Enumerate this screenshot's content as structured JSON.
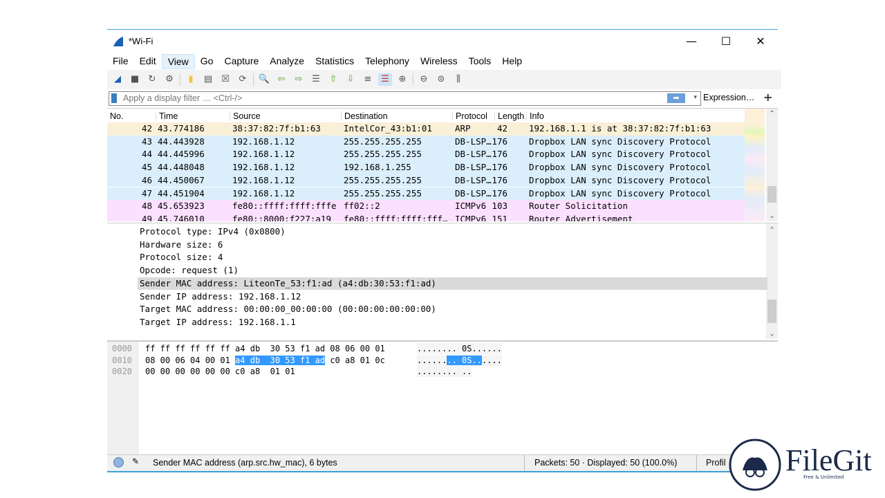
{
  "window": {
    "title": "*Wi-Fi",
    "minimize": "—",
    "maximize": "☐",
    "close": "✕"
  },
  "menu": [
    "File",
    "Edit",
    "View",
    "Go",
    "Capture",
    "Analyze",
    "Statistics",
    "Telephony",
    "Wireless",
    "Tools",
    "Help"
  ],
  "toolbar": [
    "start-capture",
    "stop-capture",
    "restart-capture",
    "capture-options",
    "open-file",
    "save-file",
    "close-file",
    "reload-file",
    "find-packet",
    "go-back",
    "go-forward",
    "go-to-packet",
    "first-packet",
    "last-packet",
    "auto-scroll",
    "colorize",
    "zoom-in",
    "zoom-out",
    "normal-size",
    "resize-columns"
  ],
  "filter": {
    "placeholder": "Apply a display filter … <Ctrl-/>",
    "apply": "➡",
    "dropdown": "▾",
    "expression": "Expression…",
    "plus": "+"
  },
  "packet_list": {
    "columns": [
      "No.",
      "Time",
      "Source",
      "Destination",
      "Protocol",
      "Length",
      "Info"
    ],
    "rows": [
      {
        "no": "42",
        "time": "43.774186",
        "src": "38:37:82:7f:b1:63",
        "dst": "IntelCor_43:b1:01",
        "proto": "ARP",
        "len": "42",
        "info": "192.168.1.1 is at 38:37:82:7f:b1:63",
        "color": "#faf0d7"
      },
      {
        "no": "43",
        "time": "44.443928",
        "src": "192.168.1.12",
        "dst": "255.255.255.255",
        "proto": "DB-LSP…",
        "len": "176",
        "info": "Dropbox LAN sync Discovery Protocol",
        "color": "#daeefb"
      },
      {
        "no": "44",
        "time": "44.445996",
        "src": "192.168.1.12",
        "dst": "255.255.255.255",
        "proto": "DB-LSP…",
        "len": "176",
        "info": "Dropbox LAN sync Discovery Protocol",
        "color": "#daeefb"
      },
      {
        "no": "45",
        "time": "44.448048",
        "src": "192.168.1.12",
        "dst": "192.168.1.255",
        "proto": "DB-LSP…",
        "len": "176",
        "info": "Dropbox LAN sync Discovery Protocol",
        "color": "#daeefb"
      },
      {
        "no": "46",
        "time": "44.450067",
        "src": "192.168.1.12",
        "dst": "255.255.255.255",
        "proto": "DB-LSP…",
        "len": "176",
        "info": "Dropbox LAN sync Discovery Protocol",
        "color": "#daeefb"
      },
      {
        "no": "47",
        "time": "44.451904",
        "src": "192.168.1.12",
        "dst": "255.255.255.255",
        "proto": "DB-LSP…",
        "len": "176",
        "info": "Dropbox LAN sync Discovery Protocol",
        "color": "#daeefb"
      },
      {
        "no": "48",
        "time": "45.653923",
        "src": "fe80::ffff:ffff:fffe",
        "dst": "ff02::2",
        "proto": "ICMPv6",
        "len": "103",
        "info": "Router Solicitation",
        "color": "#fce0ff"
      },
      {
        "no": "49",
        "time": "45.746010",
        "src": "fe80::8000:f227:a19",
        "dst": "fe80::ffff:ffff:fff…",
        "proto": "ICMPv6",
        "len": "151",
        "info": "Router Advertisement",
        "color": "#fce0ff"
      }
    ]
  },
  "details": [
    "Protocol type: IPv4 (0x0800)",
    "Hardware size: 6",
    "Protocol size: 4",
    "Opcode: request (1)",
    "Sender MAC address: LiteonTe_53:f1:ad (a4:db:30:53:f1:ad)",
    "Sender IP address: 192.168.1.12",
    "Target MAC address: 00:00:00_00:00:00 (00:00:00:00:00:00)",
    "Target IP address: 192.168.1.1"
  ],
  "hex": [
    {
      "offset": "0000",
      "pre": "ff ff ff ff ff ff a4 db  30 53 f1 ad 08 06 00 01",
      "sel": "",
      "post": "",
      "apre": "........ 0S......",
      "asel": "",
      "apost": ""
    },
    {
      "offset": "0010",
      "pre": "08 00 06 04 00 01 ",
      "sel": "a4 db  30 53 f1 ad",
      "post": " c0 a8 01 0c",
      "apre": "......",
      "asel": ".. 0S..",
      "apost": "...."
    },
    {
      "offset": "0020",
      "pre": "00 00 00 00 00 00 c0 a8  01 01",
      "sel": "",
      "post": "",
      "apre": "........ ..",
      "asel": "",
      "apost": ""
    }
  ],
  "status": {
    "field": "Sender MAC address (arp.src.hw_mac), 6 bytes",
    "packets": "Packets: 50 · Displayed: 50 (100.0%)",
    "profile": "Profil"
  },
  "watermark": {
    "name": "FileGit",
    "tagline": "Free & Unlimited"
  }
}
